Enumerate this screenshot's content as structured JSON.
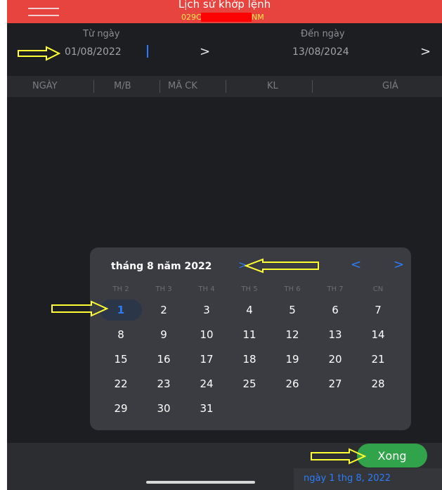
{
  "header": {
    "title": "Lịch sử khớp lệnh",
    "account_left": "029C",
    "account_right": "NM"
  },
  "filter": {
    "from_label": "Từ ngày",
    "from_value": "01/08/2022",
    "to_label": "Đến ngày",
    "to_value": "13/08/2024",
    "chevron": ">"
  },
  "table": {
    "columns": [
      "NGÀY",
      "M/B",
      "MÃ CK",
      "KL",
      "GIÁ"
    ]
  },
  "calendar": {
    "month_title": "tháng 8 năm 2022",
    "title_chevron": ">",
    "prev_icon": "<",
    "next_icon": ">",
    "weekdays": [
      "TH 2",
      "TH 3",
      "TH 4",
      "TH 5",
      "TH 6",
      "TH 7",
      "CN"
    ],
    "selected_day": 1,
    "days": [
      "1",
      "2",
      "3",
      "4",
      "5",
      "6",
      "7",
      "8",
      "9",
      "10",
      "11",
      "12",
      "13",
      "14",
      "15",
      "16",
      "17",
      "18",
      "19",
      "20",
      "21",
      "22",
      "23",
      "24",
      "25",
      "26",
      "27",
      "28",
      "29",
      "30",
      "31"
    ]
  },
  "footer": {
    "done_label": "Xong",
    "selected_date": "ngày 1 thg 8, 2022"
  },
  "colors": {
    "header_bg": "#e8443f",
    "accent_blue": "#2d7cf6",
    "done_green": "#31a34a",
    "annotation_yellow": "#ffff33"
  },
  "annotations": {
    "arrow_icon": "right-arrow-outline-icon",
    "left_arrow_icon": "left-arrow-outline-icon"
  }
}
